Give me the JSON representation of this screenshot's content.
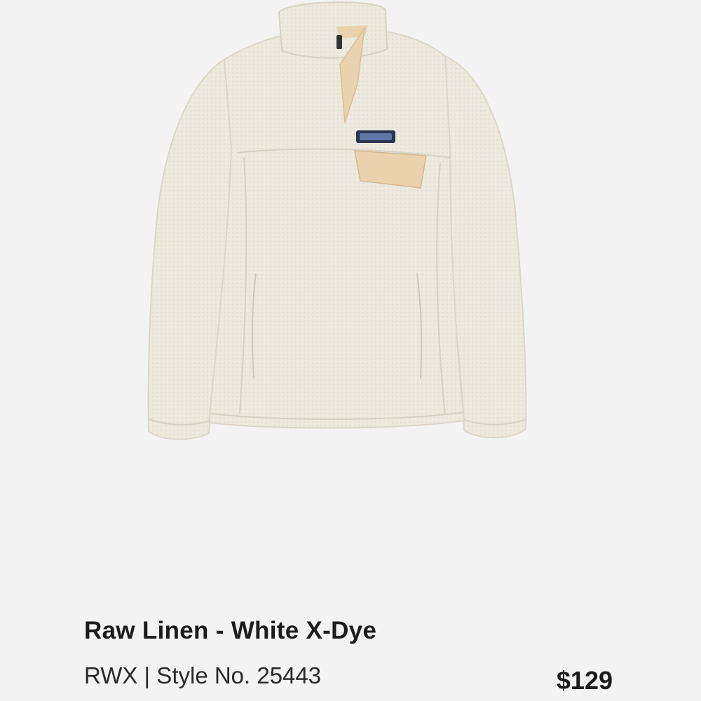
{
  "product": {
    "image_subject": "jacket-product-image",
    "colorway_name": "Raw Linen - White X-Dye",
    "style_line": "RWX | Style No. 25443",
    "price": "$129"
  },
  "colors": {
    "background": "#f3f3f3",
    "fleece": "#ece8dd",
    "placket": "#ead2ae",
    "text": "#1c1c1c"
  }
}
